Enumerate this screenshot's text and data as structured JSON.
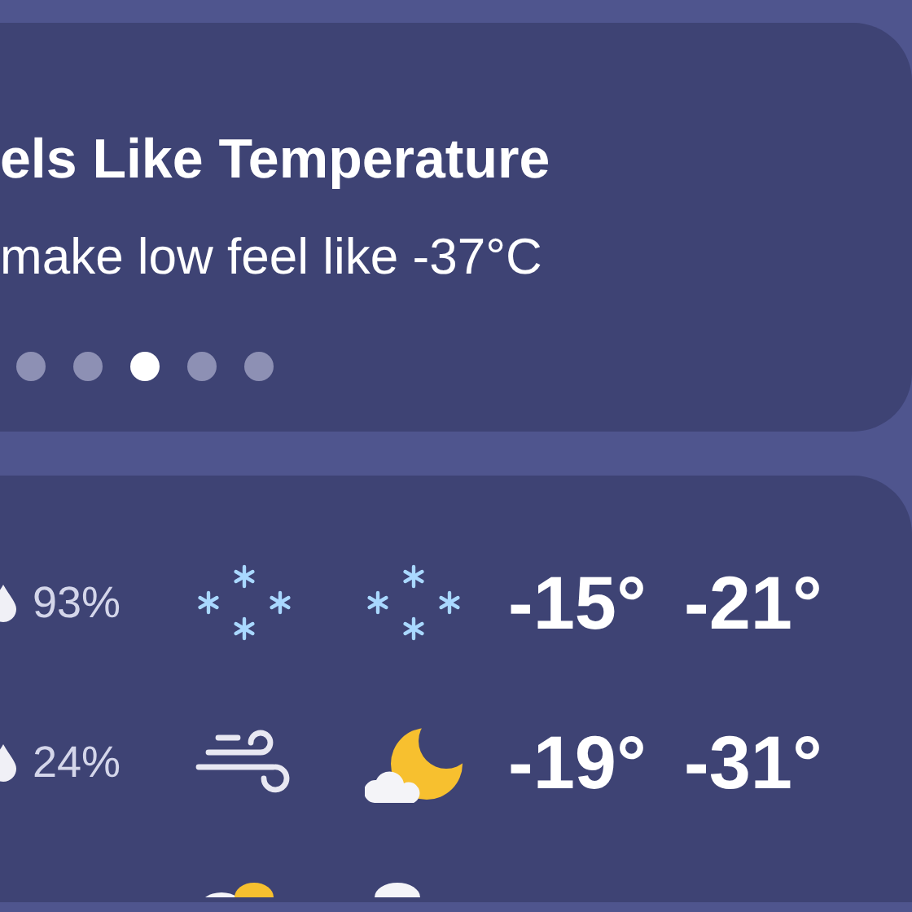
{
  "summary_card": {
    "title": "els Like Temperature",
    "text": "make low feel like -37°C",
    "pages": [
      {
        "selected": false
      },
      {
        "selected": false
      },
      {
        "selected": true
      },
      {
        "selected": false
      },
      {
        "selected": false
      }
    ]
  },
  "forecast": [
    {
      "precipitation": "93%",
      "day": {
        "kind": "snow"
      },
      "night": {
        "kind": "snow"
      },
      "high": "-15°",
      "low": "-21°"
    },
    {
      "precipitation": "24%",
      "day": {
        "kind": "wind"
      },
      "night": {
        "kind": "moon-cloud"
      },
      "high": "-19°",
      "low": "-31°"
    },
    {
      "day": {
        "kind": "sun-cloud"
      },
      "night": {
        "kind": "cloud"
      }
    }
  ]
}
